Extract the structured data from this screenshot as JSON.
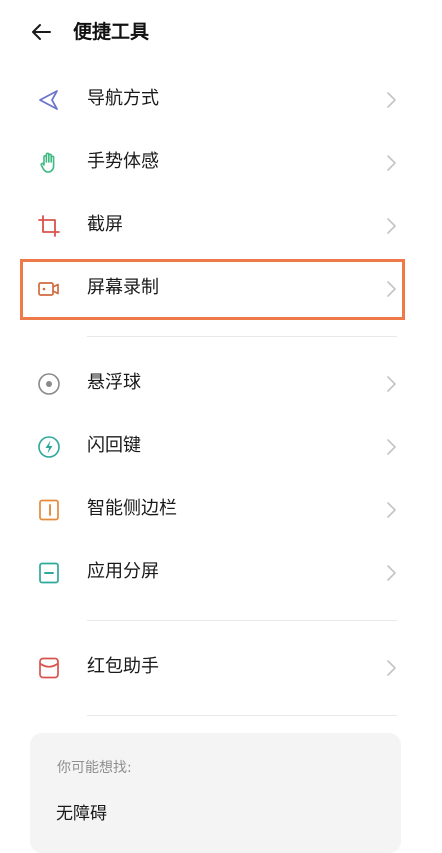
{
  "header": {
    "title": "便捷工具"
  },
  "group1": {
    "items": [
      {
        "label": "导航方式",
        "icon": "navigation-arrow-icon"
      },
      {
        "label": "手势体感",
        "icon": "hand-gesture-icon"
      },
      {
        "label": "截屏",
        "icon": "crop-screenshot-icon"
      },
      {
        "label": "屏幕录制",
        "icon": "video-camera-icon"
      }
    ]
  },
  "group2": {
    "items": [
      {
        "label": "悬浮球",
        "icon": "floating-ball-icon"
      },
      {
        "label": "闪回键",
        "icon": "lightning-icon"
      },
      {
        "label": "智能侧边栏",
        "icon": "sidebar-icon"
      },
      {
        "label": "应用分屏",
        "icon": "split-screen-icon"
      }
    ]
  },
  "group3": {
    "items": [
      {
        "label": "红包助手",
        "icon": "red-envelope-icon"
      }
    ]
  },
  "suggestions": {
    "title": "你可能想找:",
    "items": [
      "无障碍"
    ]
  },
  "colors": {
    "highlight": "#ee7a4a",
    "nav_icon": "#6a74c9",
    "gesture_icon": "#3fb982",
    "crop_icon": "#d9534f",
    "video_icon": "#d16a3e",
    "floating_icon": "#8a8a8a",
    "lightning_icon": "#2ea89a",
    "sidebar_icon": "#e58a3a",
    "split_icon": "#2ea89a",
    "envelope_icon": "#d9534f"
  }
}
